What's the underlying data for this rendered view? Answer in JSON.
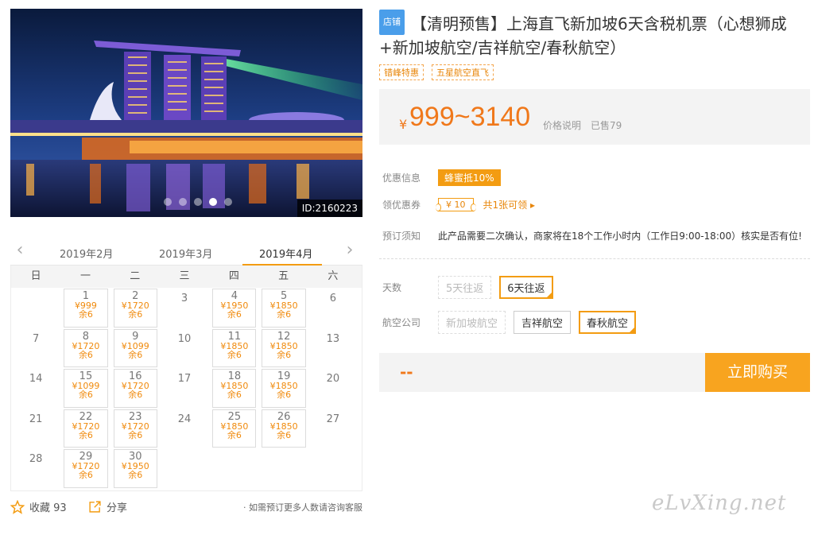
{
  "hero": {
    "id_badge": "ID:2160223",
    "dots": 5,
    "active_dot": 3
  },
  "calendar": {
    "months": [
      "2019年2月",
      "2019年3月",
      "2019年4月"
    ],
    "active_month": "2019年4月",
    "weekdays": [
      "日",
      "一",
      "二",
      "三",
      "四",
      "五",
      "六"
    ],
    "days": [
      {
        "d": "",
        "p": "",
        "s": ""
      },
      {
        "d": "1",
        "p": "¥999",
        "s": "余6"
      },
      {
        "d": "2",
        "p": "¥1720",
        "s": "余6"
      },
      {
        "d": "3",
        "p": "",
        "s": ""
      },
      {
        "d": "4",
        "p": "¥1950",
        "s": "余6"
      },
      {
        "d": "5",
        "p": "¥1850",
        "s": "余6"
      },
      {
        "d": "6",
        "p": "",
        "s": ""
      },
      {
        "d": "7",
        "p": "",
        "s": ""
      },
      {
        "d": "8",
        "p": "¥1720",
        "s": "余6"
      },
      {
        "d": "9",
        "p": "¥1099",
        "s": "余6"
      },
      {
        "d": "10",
        "p": "",
        "s": ""
      },
      {
        "d": "11",
        "p": "¥1850",
        "s": "余6"
      },
      {
        "d": "12",
        "p": "¥1850",
        "s": "余6"
      },
      {
        "d": "13",
        "p": "",
        "s": ""
      },
      {
        "d": "14",
        "p": "",
        "s": ""
      },
      {
        "d": "15",
        "p": "¥1099",
        "s": "余6"
      },
      {
        "d": "16",
        "p": "¥1720",
        "s": "余6"
      },
      {
        "d": "17",
        "p": "",
        "s": ""
      },
      {
        "d": "18",
        "p": "¥1850",
        "s": "余6"
      },
      {
        "d": "19",
        "p": "¥1850",
        "s": "余6"
      },
      {
        "d": "20",
        "p": "",
        "s": ""
      },
      {
        "d": "21",
        "p": "",
        "s": ""
      },
      {
        "d": "22",
        "p": "¥1720",
        "s": "余6"
      },
      {
        "d": "23",
        "p": "¥1720",
        "s": "余6"
      },
      {
        "d": "24",
        "p": "",
        "s": ""
      },
      {
        "d": "25",
        "p": "¥1850",
        "s": "余6"
      },
      {
        "d": "26",
        "p": "¥1850",
        "s": "余6"
      },
      {
        "d": "27",
        "p": "",
        "s": ""
      },
      {
        "d": "28",
        "p": "",
        "s": ""
      },
      {
        "d": "29",
        "p": "¥1720",
        "s": "余6"
      },
      {
        "d": "30",
        "p": "¥1950",
        "s": "余6"
      }
    ]
  },
  "share_bar": {
    "favorite": "收藏 93",
    "share": "分享",
    "tip": "· 如需预订更多人数请咨询客服"
  },
  "product": {
    "shop_tag": "店铺",
    "title": "【清明预售】上海直飞新加坡6天含税机票（心想狮成+新加坡航空/吉祥航空/春秋航空）",
    "tags": [
      "错峰特惠",
      "五星航空直飞"
    ],
    "currency": "¥",
    "price_range": "999~3140",
    "price_hint": "价格说明",
    "sold": "已售79"
  },
  "info": {
    "discount_label": "优惠信息",
    "discount_tag": "蜂蜜抵10%",
    "coupon_label": "领优惠券",
    "coupon_value": "¥ 10",
    "coupon_link": "共1张可领 ▸",
    "notice_label": "预订须知",
    "notice_text": "此产品需要二次确认，商家将在18个工作小时内（工作日9:00-18:00）核实是否有位!"
  },
  "options": {
    "days_label": "天数",
    "days": [
      {
        "label": "5天往返",
        "state": "disabled"
      },
      {
        "label": "6天往返",
        "state": "selected"
      }
    ],
    "airline_label": "航空公司",
    "airlines": [
      {
        "label": "新加坡航空",
        "state": "disabled"
      },
      {
        "label": "吉祥航空",
        "state": "normal"
      },
      {
        "label": "春秋航空",
        "state": "selected"
      }
    ]
  },
  "buy": {
    "total": "--",
    "button": "立即购买"
  },
  "watermark": "eLvXing.net",
  "colors": {
    "accent": "#f39c12",
    "price": "#f0781a",
    "shop_tag": "#4a9eea"
  }
}
